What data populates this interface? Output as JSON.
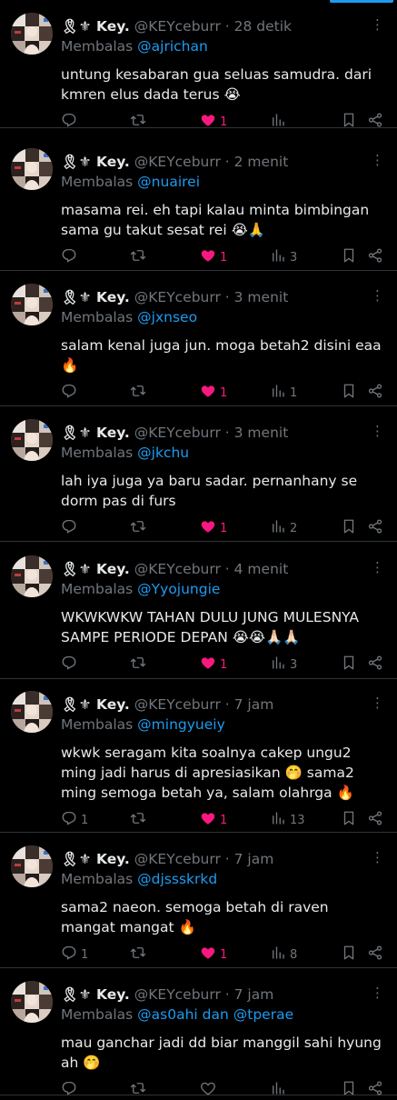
{
  "colors": {
    "accent": "#1d9bf0",
    "like": "#f91880",
    "muted": "#71767b",
    "background": "#000000"
  },
  "icons": {
    "reply": "reply-icon",
    "retweet": "retweet-icon",
    "like": "heart-icon",
    "views": "views-icon",
    "bookmark": "bookmark-icon",
    "share": "share-icon",
    "more": "more-icon"
  },
  "tweets": [
    {
      "name": "🎗⚜ Key.",
      "handle": "@KEYceburr",
      "time": "28 detik",
      "reply_label": "Membalas",
      "reply_to": "@ajrichan",
      "text": "untung kesabaran gua seluas samudra. dari kmren elus dada terus 😭",
      "replies": "",
      "retweets": "",
      "likes": "1",
      "views": ""
    },
    {
      "name": "🎗⚜ Key.",
      "handle": "@KEYceburr",
      "time": "2 menit",
      "reply_label": "Membalas",
      "reply_to": "@nuairei",
      "text": "masama rei. eh tapi kalau minta bimbingan sama gu takut sesat rei 😭🙏",
      "replies": "",
      "retweets": "",
      "likes": "1",
      "views": "3"
    },
    {
      "name": "🎗⚜ Key.",
      "handle": "@KEYceburr",
      "time": "3 menit",
      "reply_label": "Membalas",
      "reply_to": "@jxnseo",
      "text": "salam kenal juga jun. moga betah2 disini eaa 🔥",
      "replies": "",
      "retweets": "",
      "likes": "1",
      "views": "1"
    },
    {
      "name": "🎗⚜ Key.",
      "handle": "@KEYceburr",
      "time": "3 menit",
      "reply_label": "Membalas",
      "reply_to": "@jkchu",
      "text": "lah iya juga ya baru sadar. pernanhany se dorm pas di furs",
      "replies": "",
      "retweets": "",
      "likes": "1",
      "views": "2"
    },
    {
      "name": "🎗⚜ Key.",
      "handle": "@KEYceburr",
      "time": "4 menit",
      "reply_label": "Membalas",
      "reply_to": "@Yyojungie",
      "text": "WKWKWKW TAHAN DULU JUNG MULESNYA SAMPE PERIODE DEPAN 😭😭🙏🏻🙏🏻",
      "replies": "",
      "retweets": "",
      "likes": "1",
      "views": "3"
    },
    {
      "name": "🎗⚜ Key.",
      "handle": "@KEYceburr",
      "time": "7 jam",
      "reply_label": "Membalas",
      "reply_to": "@mingyueiy",
      "text": "wkwk seragam kita soalnya cakep ungu2 ming jadi harus di apresiasikan 🤭 sama2 ming semoga betah ya, salam olahrga 🔥",
      "replies": "1",
      "retweets": "",
      "likes": "1",
      "views": "13"
    },
    {
      "name": "🎗⚜ Key.",
      "handle": "@KEYceburr",
      "time": "7 jam",
      "reply_label": "Membalas",
      "reply_to": "@djssskrkd",
      "text": "sama2 naeon. semoga betah di raven mangat mangat 🔥",
      "replies": "1",
      "retweets": "",
      "likes": "1",
      "views": "8"
    },
    {
      "name": "🎗⚜ Key.",
      "handle": "@KEYceburr",
      "time": "7 jam",
      "reply_label": "Membalas",
      "reply_to": "@as0ahi dan @tperae",
      "text": "mau ganchar jadi dd biar manggil sahi hyung ah 🤭",
      "replies": "",
      "retweets": "",
      "likes": "",
      "views": ""
    }
  ]
}
